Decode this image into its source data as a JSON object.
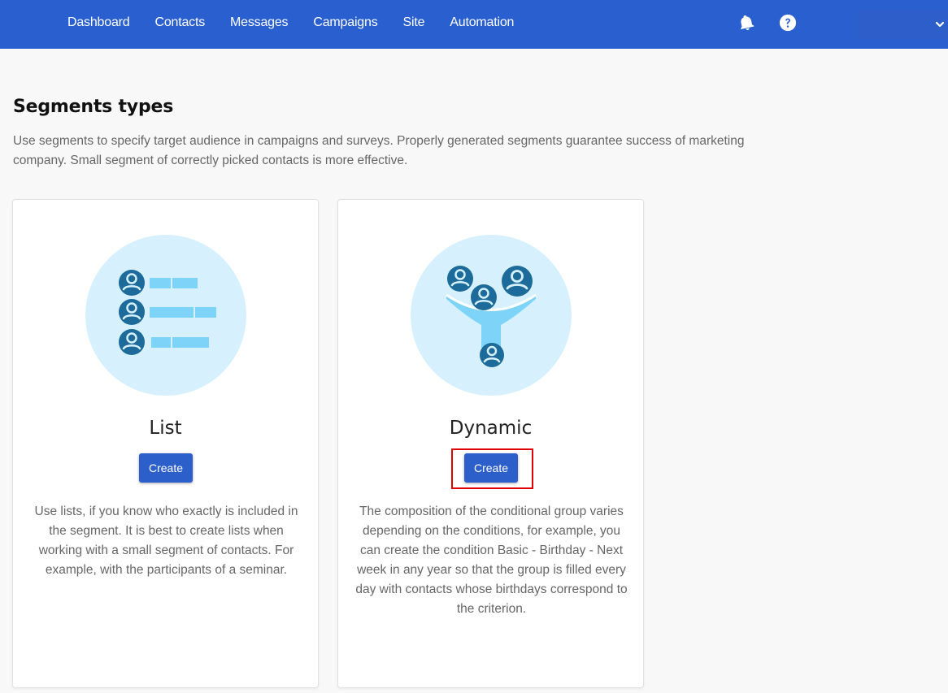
{
  "nav": {
    "items": [
      "Dashboard",
      "Contacts",
      "Messages",
      "Campaigns",
      "Site",
      "Automation"
    ]
  },
  "header_icons": {
    "notifications": "bell-icon",
    "help": "help-icon",
    "account_menu": "chevron-down-icon"
  },
  "page": {
    "title": "Segments types",
    "description": "Use segments to specify target audience in campaigns and surveys. Properly generated segments guarantee success of marketing company. Small segment of correctly picked contacts is more effective."
  },
  "cards": {
    "list": {
      "title": "List",
      "button_label": "Create",
      "description": "Use lists, if you know who exactly is included in the segment. It is best to create lists when working with a small segment of contacts. For example, with the participants of a seminar.",
      "icon": "contact-list-icon"
    },
    "dynamic": {
      "title": "Dynamic",
      "button_label": "Create",
      "description": "The composition of the conditional group varies depending on the conditions, for example, you can create the condition Basic - Birthday - Next week in any year so that the group is filled every day with contacts whose birthdays correspond to the criterion.",
      "icon": "contact-funnel-icon"
    }
  },
  "colors": {
    "header": "#2a5fcf",
    "button": "#2c5fca",
    "illustration_bg": "#d6f1fd",
    "avatar": "#1c6b9a",
    "highlight": "#e00000"
  }
}
